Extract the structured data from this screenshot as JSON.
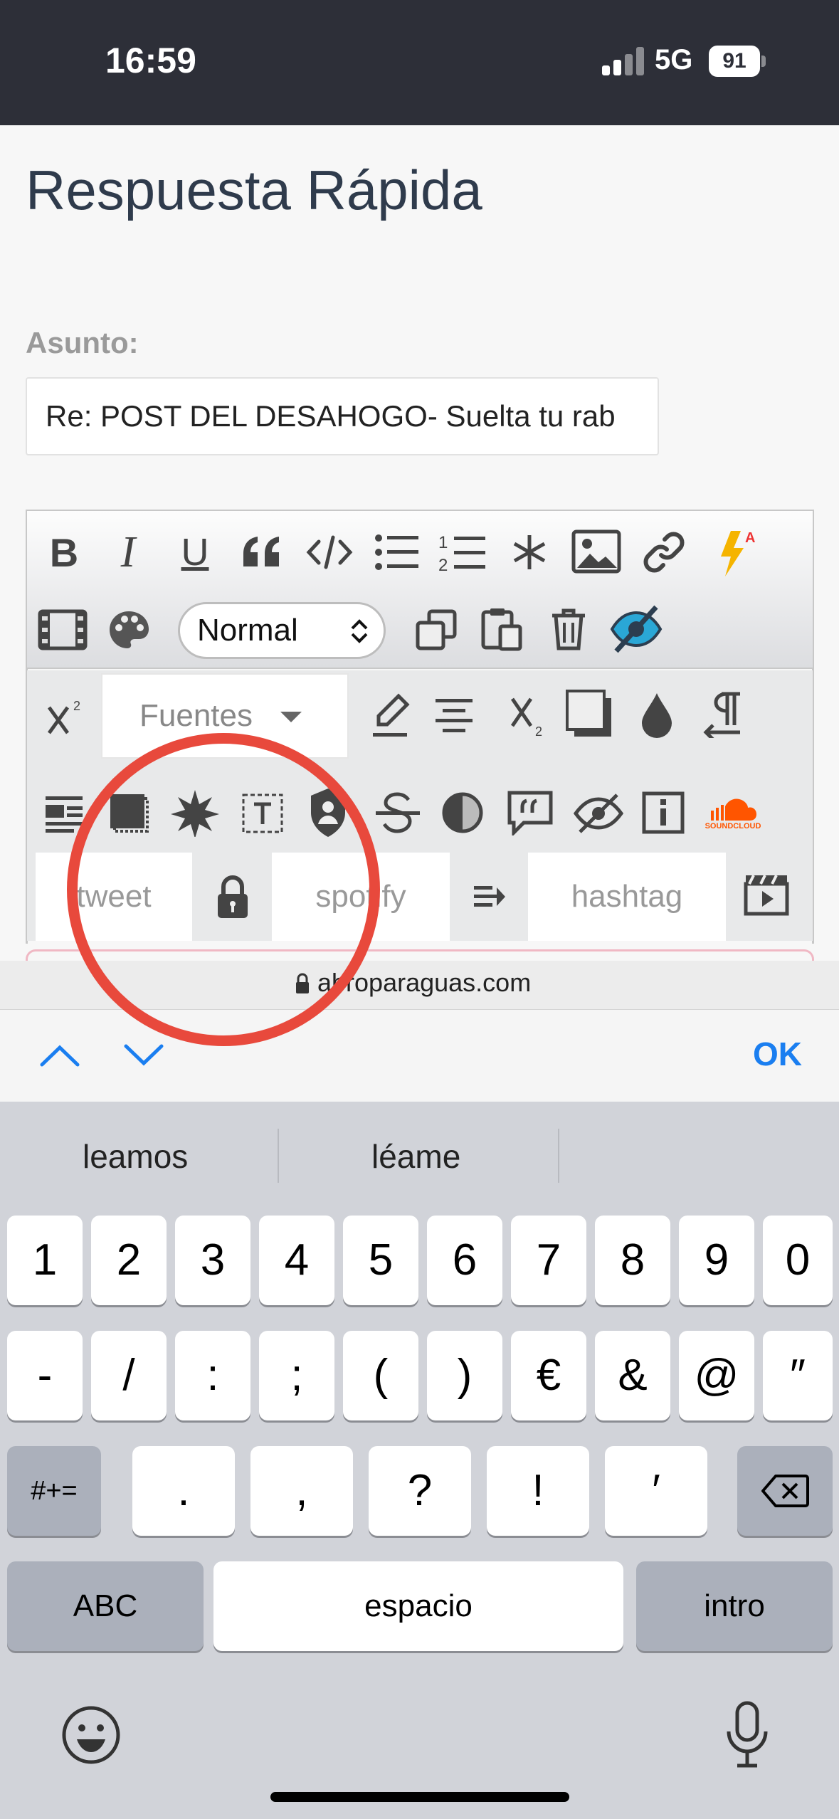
{
  "status_bar": {
    "time": "16:59",
    "network": "5G",
    "battery": "91"
  },
  "page": {
    "title": "Respuesta Rápida",
    "subject_label": "Asunto:",
    "subject_value": "Re: POST DEL DESAHOGO- Suelta tu rab"
  },
  "editor": {
    "format_select": "Normal",
    "fonts_select": "Fuentes",
    "fields": {
      "tweet": "tweet",
      "spotify": "spotify",
      "hashtag": "hashtag"
    },
    "soundcloud_text": "SOUNDCLOUD"
  },
  "browser": {
    "address": "abroparaguas.com"
  },
  "accessory": {
    "ok_label": "OK"
  },
  "keyboard": {
    "suggestions": [
      "leamos",
      "léame"
    ],
    "row1": [
      "1",
      "2",
      "3",
      "4",
      "5",
      "6",
      "7",
      "8",
      "9",
      "0"
    ],
    "row2": [
      "-",
      "/",
      ":",
      ";",
      "(",
      ")",
      "€",
      "&",
      "@",
      "″"
    ],
    "row3": [
      ".",
      ",",
      "?",
      "!",
      "′"
    ],
    "symbols_key": "#+=",
    "abc_key": "ABC",
    "space_key": "espacio",
    "return_key": "intro"
  },
  "colors": {
    "accent": "#1a7ef0",
    "annotation": "#e8493c",
    "status_bg": "#2d2f38"
  }
}
